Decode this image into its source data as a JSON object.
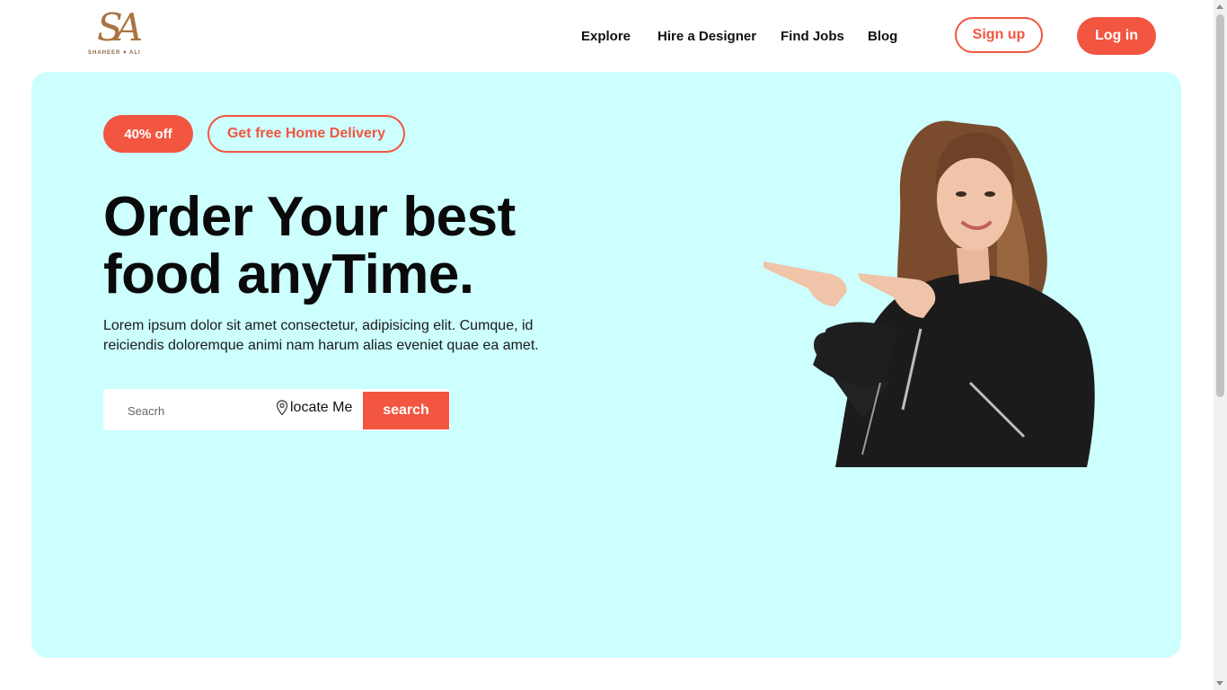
{
  "brand": {
    "monogram": "SA",
    "subtitle": "SHAHEER ♥ ALI"
  },
  "nav": [
    {
      "label": "Explore"
    },
    {
      "label": "Hire a Designer"
    },
    {
      "label": "Find Jobs"
    },
    {
      "label": "Blog"
    }
  ],
  "auth": {
    "signup_label": "Sign up",
    "login_label": "Log in"
  },
  "hero": {
    "badge_off": "40% off",
    "badge_delivery": "Get free Home Delivery",
    "headline": "Order Your best food anyTime.",
    "description": "Lorem ipsum dolor sit amet consectetur, adipisicing elit. Cumque, id reiciendis doloremque animi nam harum alias eveniet quae ea amet."
  },
  "search": {
    "placeholder": "Seacrh",
    "value": "",
    "locate_label": "locate Me",
    "button_label": "search"
  },
  "colors": {
    "accent": "#f25540",
    "hero_bg": "#ccfffe",
    "logo": "#a9743e"
  },
  "icons": {
    "locate": "map-pin-icon"
  }
}
